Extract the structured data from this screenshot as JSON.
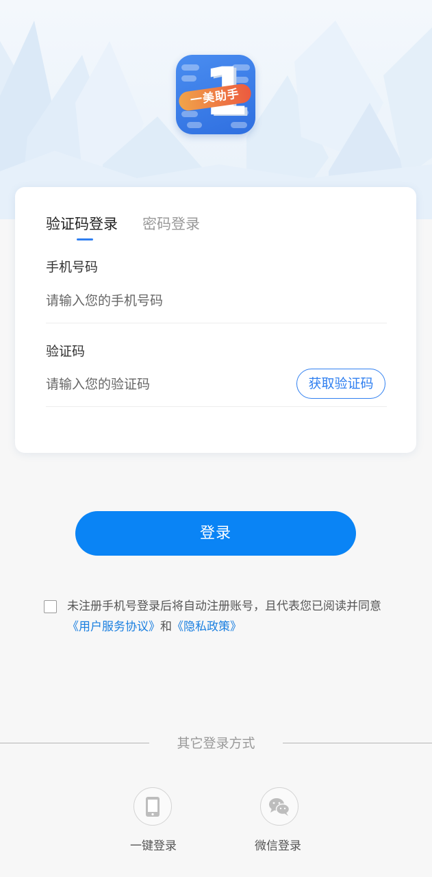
{
  "app": {
    "logo_text": "一美助手",
    "logo_digit": "1"
  },
  "login_tabs": [
    {
      "label": "验证码登录",
      "active": true
    },
    {
      "label": "密码登录",
      "active": false
    }
  ],
  "phone_field": {
    "label": "手机号码",
    "placeholder": "请输入您的手机号码",
    "value": ""
  },
  "code_field": {
    "label": "验证码",
    "placeholder": "请输入您的验证码",
    "value": "",
    "get_code_label": "获取验证码"
  },
  "login_button": {
    "label": "登录"
  },
  "agreement": {
    "checked": false,
    "text_before": "未注册手机号登录后将自动注册账号，且代表您已阅读并同意",
    "user_agreement_link": "《用户服务协议》",
    "conjunction": "和",
    "privacy_link": "《隐私政策》"
  },
  "other_login": {
    "title": "其它登录方式",
    "options": [
      {
        "label": "一键登录",
        "icon": "phone-icon"
      },
      {
        "label": "微信登录",
        "icon": "wechat-icon"
      }
    ]
  },
  "colors": {
    "accent": "#0a84f5",
    "link": "#1a7fe0",
    "tab_indicator": "#2f7ff0",
    "background": "#f7f7f7"
  }
}
